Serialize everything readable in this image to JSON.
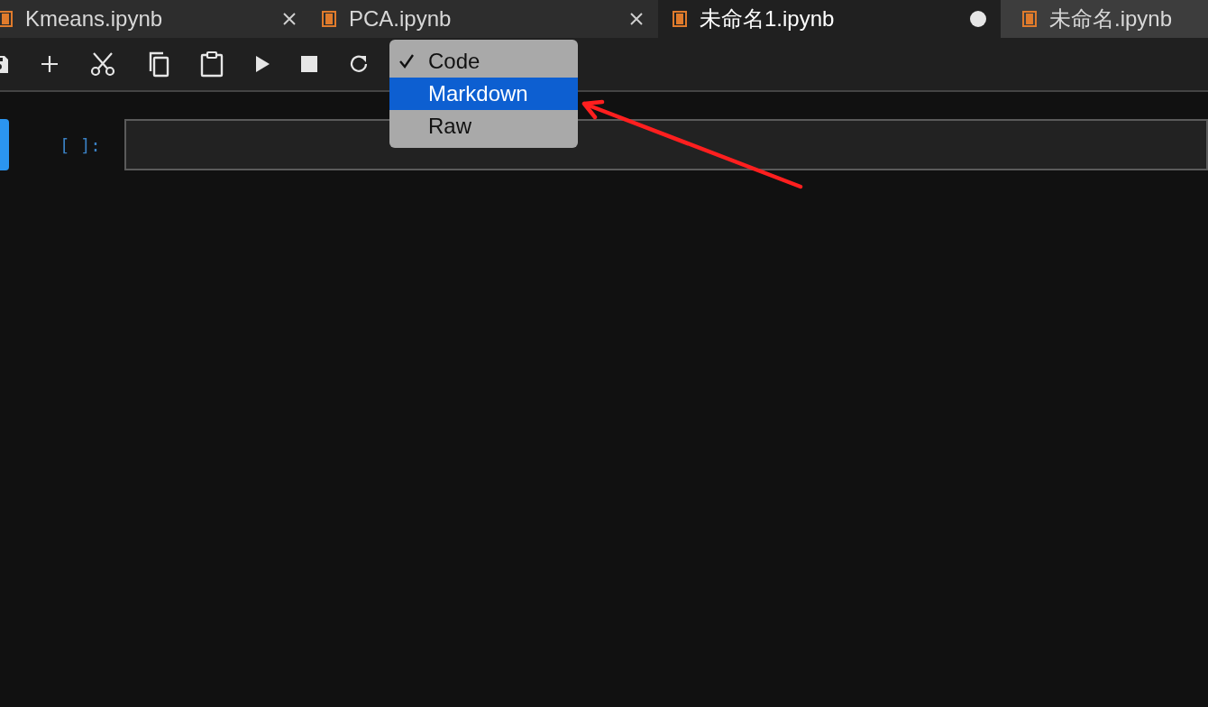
{
  "tabs": [
    {
      "label": "Kmeans.ipynb",
      "selected": false,
      "unsaved": false
    },
    {
      "label": "PCA.ipynb",
      "selected": false,
      "unsaved": false
    },
    {
      "label": "未命名1.ipynb",
      "selected": true,
      "unsaved": true
    },
    {
      "label": "未命名.ipynb",
      "selected": false
    }
  ],
  "cell_type_menu": {
    "items": [
      {
        "label": "Code",
        "checked": true,
        "selected": false
      },
      {
        "label": "Markdown",
        "checked": false,
        "selected": true
      },
      {
        "label": "Raw",
        "checked": false,
        "selected": false
      }
    ]
  },
  "cell": {
    "prompt": "[ ]:",
    "active": true
  }
}
